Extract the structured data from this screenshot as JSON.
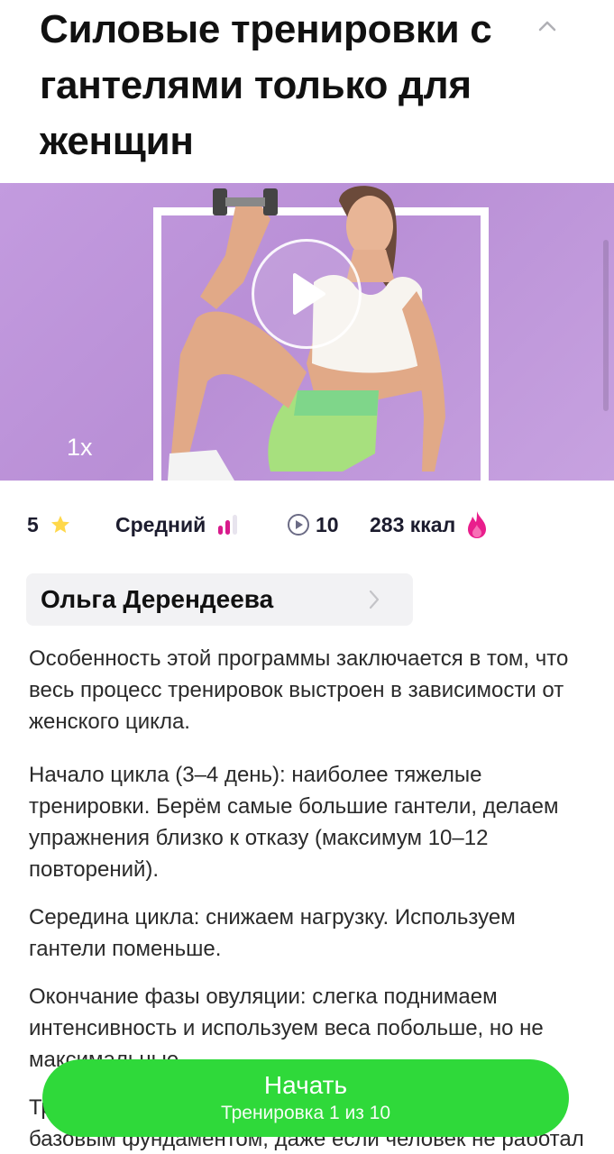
{
  "title": "Силовые тренировки с гантелями только для женщин",
  "video": {
    "speed_label": "1x"
  },
  "stats": {
    "rating": "5",
    "level": "Средний",
    "videos": "10",
    "calories": "283 ккал"
  },
  "author": {
    "name": "Ольга Дерендеева"
  },
  "description": [
    "Особенность этой программы заключается в том, что весь процесс тренировок выстроен в зависимости от женского цикла.",
    "Начало цикла (3–4 день): наиболее тяжелые тренировки. Берём самые большие гантели, делаем упражнения близко к отказу (максимум 10–12 повторений).",
    "Середина цикла: снижаем нагрузку. Используем гантели поменьше.",
    "Окончание фазы овуляции: слегка поднимаем интенсивность и используем веса побольше, но не максимальные.",
    "Тренировки подойдут и новичкам, чтобы стать базовым фундаментом, даже если человек не работал с гантелями."
  ],
  "start_button": {
    "label": "Начать",
    "sublabel": "Тренировка 1 из 10"
  },
  "colors": {
    "accent_green": "#2fd93a",
    "video_bg": "#c39bdf",
    "level_bar_active": "#d81b8c",
    "flame": "#e91e8c",
    "star": "#ffd84a"
  },
  "icons": [
    "chevron-up-icon",
    "play-icon",
    "star-icon",
    "level-bars-icon",
    "video-count-icon",
    "flame-icon",
    "chevron-right-icon"
  ]
}
